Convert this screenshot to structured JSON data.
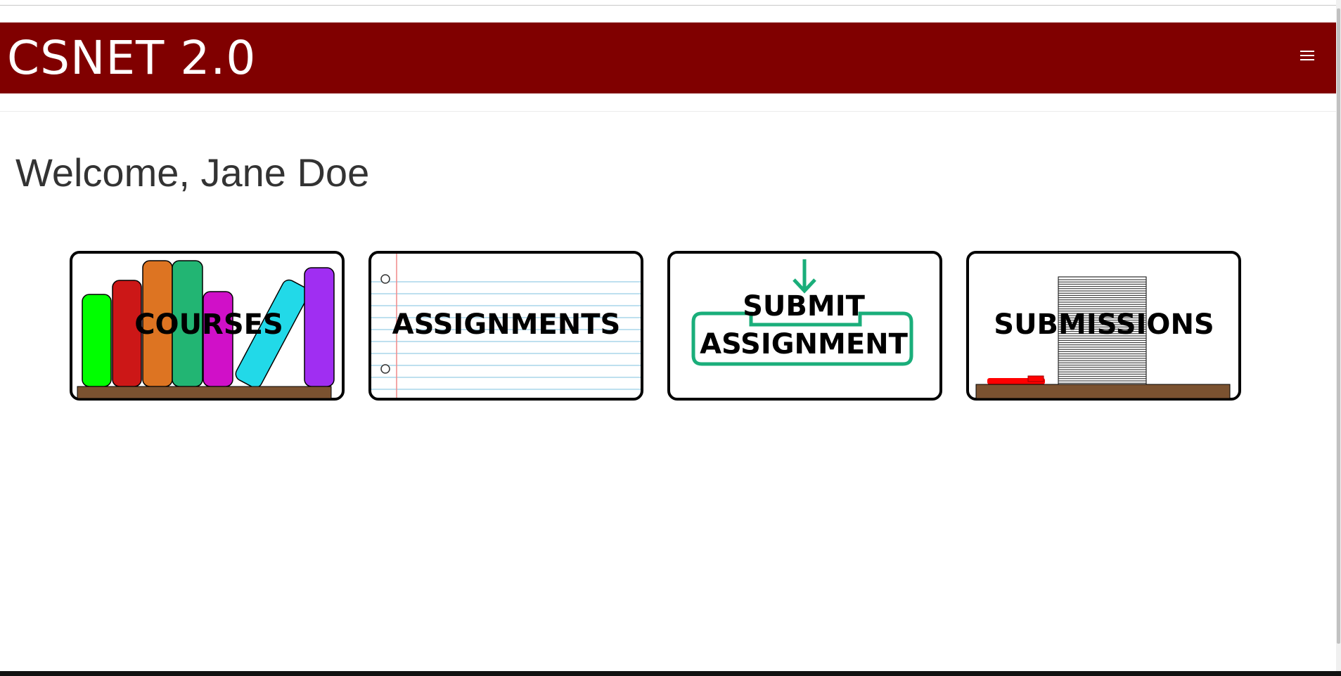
{
  "header": {
    "brand": "CSNET 2.0",
    "background_color": "#800000",
    "menu_icon": "hamburger-icon"
  },
  "main": {
    "welcome": "Welcome, Jane Doe"
  },
  "tiles": [
    {
      "label": "COURSES",
      "image": "bookshelf-icon"
    },
    {
      "label": "ASSIGNMENTS",
      "image": "notebook-paper-icon"
    },
    {
      "label_line1": "SUBMIT",
      "label_line2": "ASSIGNMENT",
      "image": "download-arrow-icon",
      "accent_color": "#1aae7a"
    },
    {
      "label": "SUBMISSIONS",
      "image": "paper-stack-icon"
    }
  ]
}
